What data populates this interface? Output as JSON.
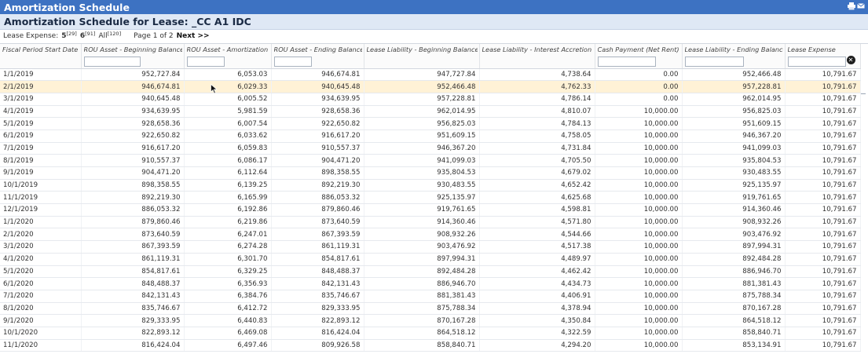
{
  "window": {
    "title": "Amortization Schedule",
    "icons": [
      "print-icon",
      "email-icon"
    ]
  },
  "subheader": {
    "title": "Amortization Schedule for Lease: _CC A1 IDC"
  },
  "filter": {
    "label": "Lease Expense:",
    "opt1": "5",
    "opt1_count": "[29]",
    "opt2": "6",
    "opt2_count": "[91]",
    "opt3": "All",
    "opt3_count": "[120]",
    "page": "Page 1 of 2",
    "next": "Next >>"
  },
  "columns": [
    "Fiscal Period Start Date",
    "ROU Asset - Beginning Balance",
    "ROU Asset - Amortization",
    "ROU Asset - Ending Balance",
    "Lease Liability - Beginning Balance",
    "Lease Liability - Interest Accretion",
    "Cash Payment (Net Rent)",
    "Lease Liability - Ending Balance",
    "Lease Expense"
  ],
  "rows": [
    [
      "1/1/2019",
      "952,727.84",
      "6,053.03",
      "946,674.81",
      "947,727.84",
      "4,738.64",
      "0.00",
      "952,466.48",
      "10,791.67"
    ],
    [
      "2/1/2019",
      "946,674.81",
      "6,029.33",
      "940,645.48",
      "952,466.48",
      "4,762.33",
      "0.00",
      "957,228.81",
      "10,791.67"
    ],
    [
      "3/1/2019",
      "940,645.48",
      "6,005.52",
      "934,639.95",
      "957,228.81",
      "4,786.14",
      "0.00",
      "962,014.95",
      "10,791.67"
    ],
    [
      "4/1/2019",
      "934,639.95",
      "5,981.59",
      "928,658.36",
      "962,014.95",
      "4,810.07",
      "10,000.00",
      "956,825.03",
      "10,791.67"
    ],
    [
      "5/1/2019",
      "928,658.36",
      "6,007.54",
      "922,650.82",
      "956,825.03",
      "4,784.13",
      "10,000.00",
      "951,609.15",
      "10,791.67"
    ],
    [
      "6/1/2019",
      "922,650.82",
      "6,033.62",
      "916,617.20",
      "951,609.15",
      "4,758.05",
      "10,000.00",
      "946,367.20",
      "10,791.67"
    ],
    [
      "7/1/2019",
      "916,617.20",
      "6,059.83",
      "910,557.37",
      "946,367.20",
      "4,731.84",
      "10,000.00",
      "941,099.03",
      "10,791.67"
    ],
    [
      "8/1/2019",
      "910,557.37",
      "6,086.17",
      "904,471.20",
      "941,099.03",
      "4,705.50",
      "10,000.00",
      "935,804.53",
      "10,791.67"
    ],
    [
      "9/1/2019",
      "904,471.20",
      "6,112.64",
      "898,358.55",
      "935,804.53",
      "4,679.02",
      "10,000.00",
      "930,483.55",
      "10,791.67"
    ],
    [
      "10/1/2019",
      "898,358.55",
      "6,139.25",
      "892,219.30",
      "930,483.55",
      "4,652.42",
      "10,000.00",
      "925,135.97",
      "10,791.67"
    ],
    [
      "11/1/2019",
      "892,219.30",
      "6,165.99",
      "886,053.32",
      "925,135.97",
      "4,625.68",
      "10,000.00",
      "919,761.65",
      "10,791.67"
    ],
    [
      "12/1/2019",
      "886,053.32",
      "6,192.86",
      "879,860.46",
      "919,761.65",
      "4,598.81",
      "10,000.00",
      "914,360.46",
      "10,791.67"
    ],
    [
      "1/1/2020",
      "879,860.46",
      "6,219.86",
      "873,640.59",
      "914,360.46",
      "4,571.80",
      "10,000.00",
      "908,932.26",
      "10,791.67"
    ],
    [
      "2/1/2020",
      "873,640.59",
      "6,247.01",
      "867,393.59",
      "908,932.26",
      "4,544.66",
      "10,000.00",
      "903,476.92",
      "10,791.67"
    ],
    [
      "3/1/2020",
      "867,393.59",
      "6,274.28",
      "861,119.31",
      "903,476.92",
      "4,517.38",
      "10,000.00",
      "897,994.31",
      "10,791.67"
    ],
    [
      "4/1/2020",
      "861,119.31",
      "6,301.70",
      "854,817.61",
      "897,994.31",
      "4,489.97",
      "10,000.00",
      "892,484.28",
      "10,791.67"
    ],
    [
      "5/1/2020",
      "854,817.61",
      "6,329.25",
      "848,488.37",
      "892,484.28",
      "4,462.42",
      "10,000.00",
      "886,946.70",
      "10,791.67"
    ],
    [
      "6/1/2020",
      "848,488.37",
      "6,356.93",
      "842,131.43",
      "886,946.70",
      "4,434.73",
      "10,000.00",
      "881,381.43",
      "10,791.67"
    ],
    [
      "7/1/2020",
      "842,131.43",
      "6,384.76",
      "835,746.67",
      "881,381.43",
      "4,406.91",
      "10,000.00",
      "875,788.34",
      "10,791.67"
    ],
    [
      "8/1/2020",
      "835,746.67",
      "6,412.72",
      "829,333.95",
      "875,788.34",
      "4,378.94",
      "10,000.00",
      "870,167.28",
      "10,791.67"
    ],
    [
      "9/1/2020",
      "829,333.95",
      "6,440.83",
      "822,893.12",
      "870,167.28",
      "4,350.84",
      "10,000.00",
      "864,518.12",
      "10,791.67"
    ],
    [
      "10/1/2020",
      "822,893.12",
      "6,469.08",
      "816,424.04",
      "864,518.12",
      "4,322.59",
      "10,000.00",
      "858,840.71",
      "10,791.67"
    ],
    [
      "11/1/2020",
      "816,424.04",
      "6,497.46",
      "809,926.58",
      "858,840.71",
      "4,294.20",
      "10,000.00",
      "853,134.91",
      "10,791.67"
    ]
  ],
  "selected_row": 1,
  "colors": {
    "titlebar": "#3d72c2",
    "subheader": "#dfe8f5",
    "selected_row": "#fff2d6"
  }
}
